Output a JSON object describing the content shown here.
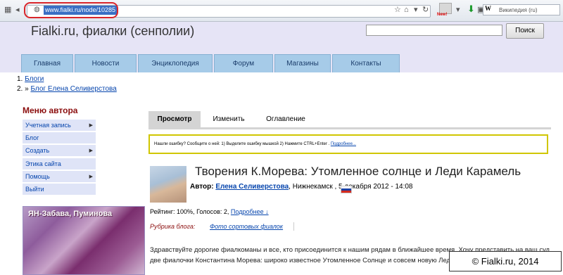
{
  "browser": {
    "url": "www.fialki.ru/node/10285",
    "search_engine_label": "Википедия (ru)",
    "new_badge": "New!"
  },
  "site": {
    "title": "Fialki.ru, фиалки (сенполии)",
    "search_button": "Поиск",
    "search_value": ""
  },
  "nav": {
    "items": [
      "Главная",
      "Новости",
      "Энциклопедия",
      "Форум",
      "Магазины",
      "Контакты"
    ]
  },
  "breadcrumb": {
    "item1_num": "1.",
    "item1": "Блоги",
    "item2_num": "2. »",
    "item2": "Блог Елена Селиверстова"
  },
  "author_menu": {
    "title": "Меню автора",
    "items": [
      "Учетная запись",
      "Блог",
      "Создать",
      "Этика сайта",
      "Помощь",
      "Выйти"
    ]
  },
  "photo": {
    "caption": "ЯН-Забава, Пуминова"
  },
  "tabs": {
    "view": "Просмотр",
    "edit": "Изменить",
    "toc": "Оглавление"
  },
  "notice": {
    "text": "Нашли ошибку? Сообщите о ней: 1) Выделите ошибку мышкой 2) Нажмите CTRL+Enter .",
    "link": "Подробнее..."
  },
  "article": {
    "title": "Творения К.Морева: Утомленное солнце и Леди Карамель",
    "author_label": "Автор:",
    "author": "Елена Селиверстова",
    "location_date": ", Нижнекамск , 5 декабря 2012 - 14:08",
    "rating": "Рейтинг: 100%, Голосов: 2,",
    "rating_link": "Подробнее ↓",
    "rubric_label": "Рубрика блога:",
    "rubric_link": "Фото сортовых фиалок",
    "body": "Здравствуйте дорогие фиалкоманы и все, кто присоединится к нашим рядам в ближайшее время. Хочу представить на ваш суд две фиалочки Константина Морева: широко известное Утомленное Солнце и совсем новую Леди Карамель."
  },
  "copyright": "© Fialki.ru, 2014"
}
